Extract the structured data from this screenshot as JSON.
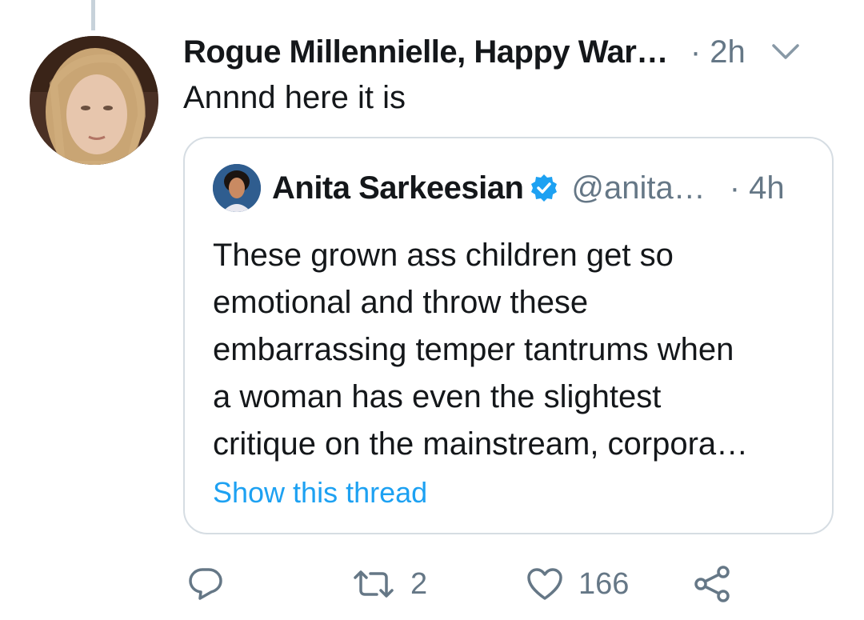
{
  "tweet": {
    "author_name": "Rogue Millennielle, Happy War…",
    "time": "· 2h",
    "text": "Annnd here it is"
  },
  "quote": {
    "author_name": "Anita Sarkeesian",
    "handle": "@anita…",
    "time": "· 4h",
    "body_lines": [
      "These grown ass children get so",
      "emotional and throw these",
      "embarrassing temper tantrums when",
      "a woman has even the slightest",
      "critique on the mainstream, corpora…"
    ],
    "show_thread": "Show this thread"
  },
  "actions": {
    "reply_icon": "reply-icon",
    "retweet_count": "2",
    "like_count": "166",
    "share_icon": "share-icon"
  },
  "colors": {
    "text": "#14171a",
    "muted": "#657786",
    "link": "#1da1f2",
    "border": "#d6dde3",
    "verified": "#1da1f2"
  }
}
